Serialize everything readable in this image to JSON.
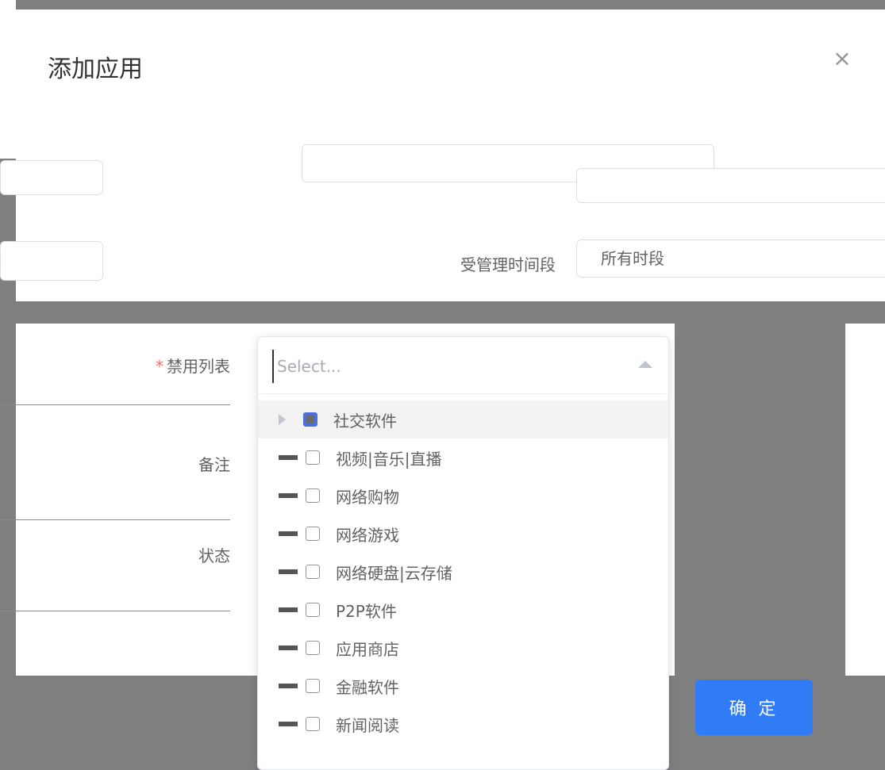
{
  "dialog": {
    "title": "添加应用",
    "close_icon": "close-icon"
  },
  "form": {
    "time_period_label": "受管理时间段",
    "time_period_value": "所有时段",
    "blocklist_label": "禁用列表",
    "blocklist_required_mark": "*",
    "remark_label": "备注",
    "status_label": "状态"
  },
  "dropdown": {
    "search_placeholder": "Select...",
    "items": [
      {
        "label": "社交软件",
        "state": "indeterminate",
        "expandable": true
      },
      {
        "label": "视频|音乐|直播",
        "state": "unchecked",
        "expandable": false
      },
      {
        "label": "网络购物",
        "state": "unchecked",
        "expandable": false
      },
      {
        "label": "网络游戏",
        "state": "unchecked",
        "expandable": false
      },
      {
        "label": "网络硬盘|云存储",
        "state": "unchecked",
        "expandable": false
      },
      {
        "label": "P2P软件",
        "state": "unchecked",
        "expandable": false
      },
      {
        "label": "应用商店",
        "state": "unchecked",
        "expandable": false
      },
      {
        "label": "金融软件",
        "state": "unchecked",
        "expandable": false
      },
      {
        "label": "新闻阅读",
        "state": "unchecked",
        "expandable": false
      }
    ]
  },
  "footer": {
    "confirm_label": "确 定"
  },
  "colors": {
    "primary": "#2f7cf6",
    "required": "#f56c6c",
    "overlay": "#7f7f7f"
  }
}
